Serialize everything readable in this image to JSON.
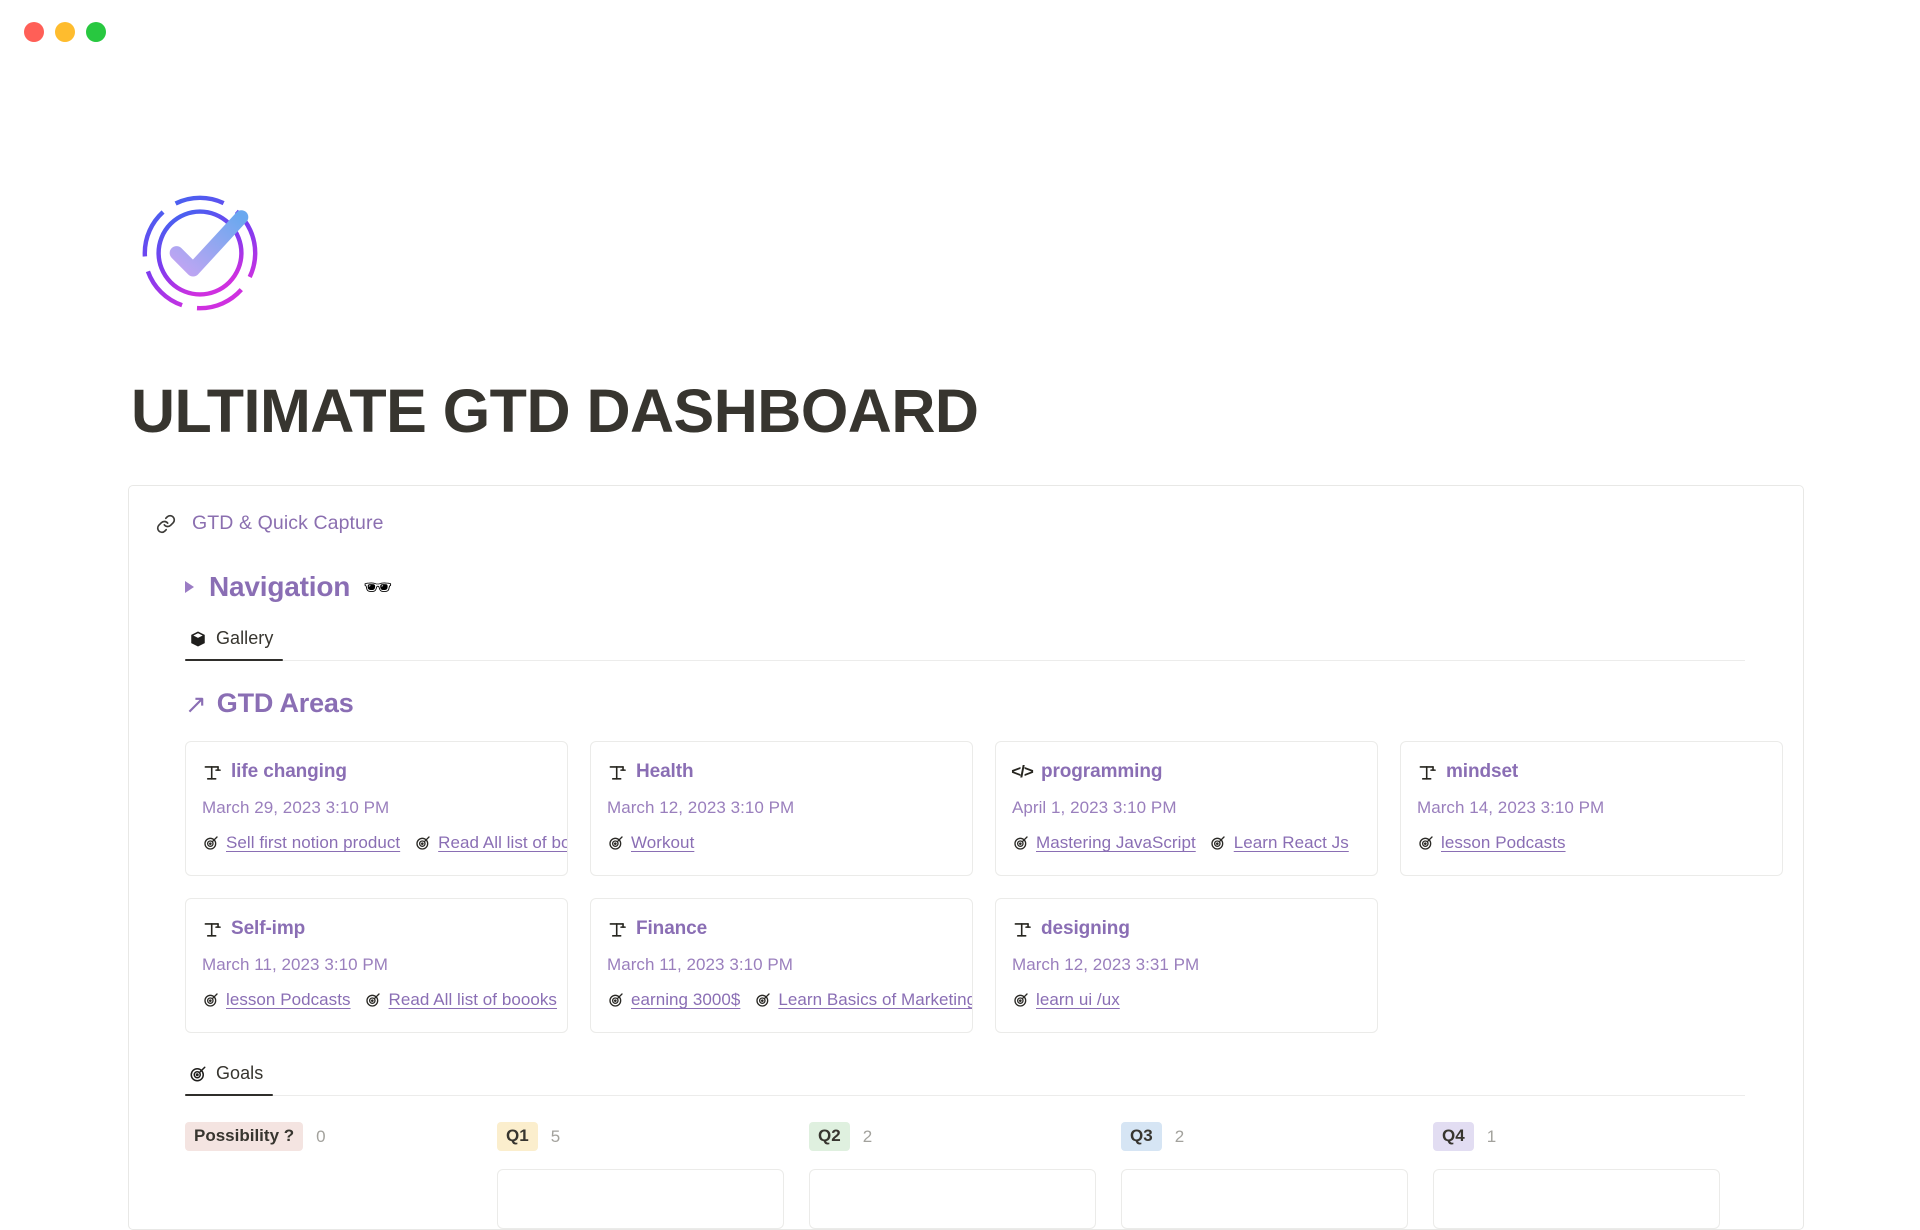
{
  "window": {
    "traffic_lights": [
      {
        "name": "close",
        "color": "#ff5f57"
      },
      {
        "name": "minimize",
        "color": "#febc2e"
      },
      {
        "name": "zoom",
        "color": "#28c840"
      }
    ]
  },
  "logo": {
    "icon": "gauge-check-icon",
    "gradient_from": "#3b6bf0",
    "gradient_to": "#cf30e0"
  },
  "header": {
    "title": "ULTIMATE GTD DASHBOARD"
  },
  "quick_link": {
    "icon": "link-icon",
    "label": "GTD & Quick Capture",
    "color": "#8b6fb0"
  },
  "navigation": {
    "toggle_icon": "collapsed-triangle-icon",
    "title": "Navigation",
    "emoji": "🕶",
    "color": "#8a6eb4"
  },
  "gallery_tabbar": {
    "tabs": [
      {
        "icon": "gallery-box-icon",
        "label": "Gallery",
        "active": true
      }
    ]
  },
  "areas_section": {
    "arrow_icon": "↗",
    "title": "GTD Areas",
    "color": "#8a6eb4",
    "cards": [
      {
        "icon": "crane-icon",
        "name": "life changing",
        "date": "March 29, 2023 3:10 PM",
        "goals": [
          "Sell first notion product",
          "Read All list of boooks"
        ]
      },
      {
        "icon": "crane-icon",
        "name": "Health",
        "date": "March 12, 2023 3:10 PM",
        "goals": [
          "Workout"
        ]
      },
      {
        "icon": "code-icon",
        "name": "programming",
        "date": "April 1, 2023 3:10 PM",
        "goals": [
          "Mastering JavaScript",
          "Learn React Js"
        ]
      },
      {
        "icon": "crane-icon",
        "name": "mindset",
        "date": "March 14, 2023 3:10 PM",
        "goals": [
          "lesson Podcasts"
        ]
      },
      {
        "icon": "crane-icon",
        "name": "Self-imp",
        "date": "March 11, 2023 3:10 PM",
        "goals": [
          "lesson Podcasts",
          "Read All list of boooks"
        ]
      },
      {
        "icon": "crane-icon",
        "name": "Finance",
        "date": "March 11, 2023 3:10 PM",
        "goals": [
          "earning 3000$",
          "Learn Basics of Marketing"
        ]
      },
      {
        "icon": "crane-icon",
        "name": "designing",
        "date": "March 12, 2023 3:31 PM",
        "goals": [
          "learn ui /ux"
        ]
      }
    ]
  },
  "goals_tabbar": {
    "tabs": [
      {
        "icon": "dart-icon",
        "label": "Goals",
        "active": true
      }
    ]
  },
  "goals_board": {
    "columns": [
      {
        "badge": "Possibility ?",
        "badge_bg": "#f4e4e1",
        "count": "0"
      },
      {
        "badge": "Q1",
        "badge_bg": "#fbeecd",
        "count": "5"
      },
      {
        "badge": "Q2",
        "badge_bg": "#dff0df",
        "count": "2"
      },
      {
        "badge": "Q3",
        "badge_bg": "#d6e5f4",
        "count": "2"
      },
      {
        "badge": "Q4",
        "badge_bg": "#e2ddf2",
        "count": "1"
      }
    ]
  }
}
